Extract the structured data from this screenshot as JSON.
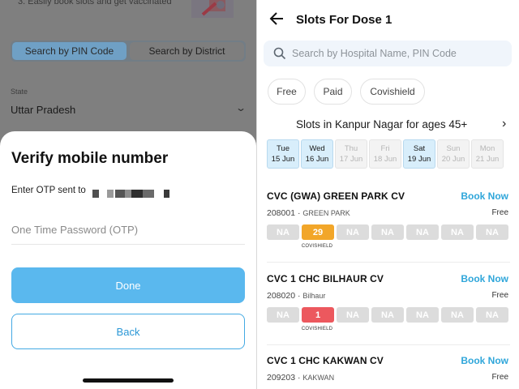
{
  "left": {
    "banner_text": "3. Easily book slots and get vaccinated",
    "tabs": [
      {
        "label": "Search by PIN Code",
        "active": true
      },
      {
        "label": "Search by District",
        "active": false
      }
    ],
    "state_label": "State",
    "state_value": "Uttar Pradesh",
    "sheet": {
      "title": "Verify mobile number",
      "otp_sent_label": "Enter OTP sent to",
      "otp_placeholder": "One Time Password (OTP)",
      "done_label": "Done",
      "back_label": "Back"
    }
  },
  "right": {
    "title": "Slots For Dose 1",
    "search_placeholder": "Search by Hospital Name, PIN Code",
    "filters": [
      "Free",
      "Paid",
      "Covishield"
    ],
    "age_title": "Slots in Kanpur Nagar for ages 45+",
    "days": [
      {
        "dow": "Tue",
        "date": "15 Jun",
        "available": true
      },
      {
        "dow": "Wed",
        "date": "16 Jun",
        "available": true
      },
      {
        "dow": "Thu",
        "date": "17 Jun",
        "available": false
      },
      {
        "dow": "Fri",
        "date": "18 Jun",
        "available": false
      },
      {
        "dow": "Sat",
        "date": "19 Jun",
        "available": true
      },
      {
        "dow": "Sun",
        "date": "20 Jun",
        "available": false
      },
      {
        "dow": "Mon",
        "date": "21 Jun",
        "available": false
      }
    ],
    "centers": [
      {
        "name": "CVC (GWA) GREEN PARK CV",
        "pin": "208001",
        "area": "GREEN PARK",
        "fee": "Free",
        "book_label": "Book Now",
        "slots": [
          "NA",
          "29",
          "NA",
          "NA",
          "NA",
          "NA",
          "NA"
        ],
        "vaccine": "COVISHIELD"
      },
      {
        "name": "CVC 1 CHC BILHAUR CV",
        "pin": "208020",
        "area": "Bilhaur",
        "fee": "Free",
        "book_label": "Book Now",
        "slots": [
          "NA",
          "1",
          "NA",
          "NA",
          "NA",
          "NA",
          "NA"
        ],
        "vaccine": "COVISHIELD"
      },
      {
        "name": "CVC 1 CHC KAKWAN CV",
        "pin": "209203",
        "area": "KAKWAN",
        "fee": "Free",
        "book_label": "Book Now"
      }
    ]
  },
  "colors": {
    "accent_blue": "#2fa6da",
    "done_button": "#5ab8ee",
    "slot_orange": "#f2a629",
    "slot_red": "#ec585e",
    "slot_na": "#dcdcdc",
    "overlay": "#7f7f7f"
  },
  "icons": {
    "back": "arrow-left-icon",
    "search": "magnifier-icon",
    "chevron_right": "chevron-right-icon",
    "chevron_down": "chevron-down-icon"
  }
}
